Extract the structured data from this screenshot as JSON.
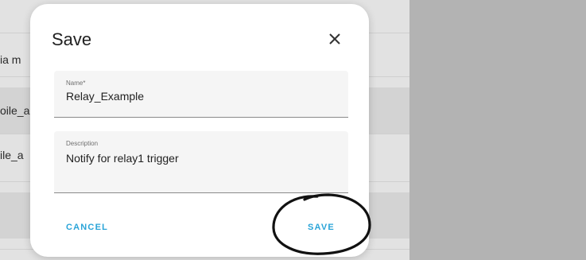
{
  "background": {
    "rows": [
      {
        "text": "ia m"
      },
      {
        "text": "oile_a"
      },
      {
        "text": "ile_a"
      }
    ]
  },
  "dialog": {
    "title": "Save",
    "close_icon": "close-icon",
    "fields": {
      "name": {
        "label": "Name*",
        "value": "Relay_Example"
      },
      "description": {
        "label": "Description",
        "value": "Notify for relay1 trigger"
      }
    },
    "buttons": {
      "cancel": "CANCEL",
      "save": "SAVE"
    },
    "accent_color": "#2aa4d8",
    "annotation": "hand-drawn-circle"
  }
}
